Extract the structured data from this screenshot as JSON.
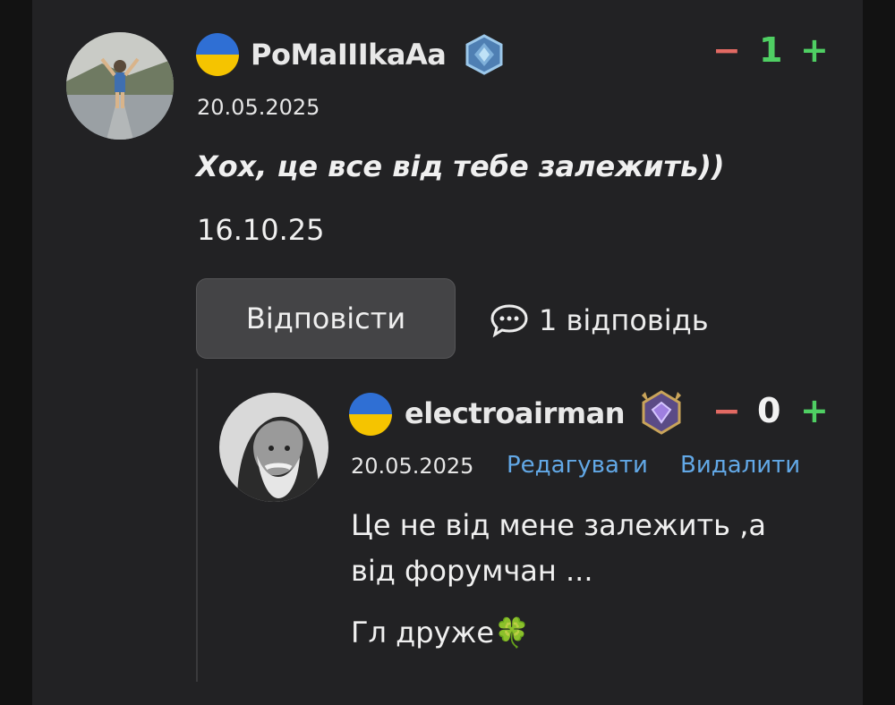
{
  "comment": {
    "username": "PoMaIIIkaAa",
    "date": "20.05.2025",
    "text_italic": "Хох, це все від тебе залежить))",
    "text_line": "16.10.25",
    "votes": {
      "minus": "−",
      "count": "1",
      "plus": "+"
    },
    "reply_button_label": "Відповісти",
    "replies_label": "1 відповідь"
  },
  "reply": {
    "username": "electroairman",
    "date": "20.05.2025",
    "edit_label": "Редагувати",
    "delete_label": "Видалити",
    "votes": {
      "minus": "−",
      "count": "0",
      "plus": "+"
    },
    "text_line1": "Це не від мене залежить ,а",
    "text_line2": "від форумчан ...",
    "text_line3": "Гл друже🍀"
  },
  "colors": {
    "background": "#222224",
    "vote_minus": "#e26a63",
    "vote_plus": "#4fcf63",
    "link": "#62a8e6",
    "flag_blue": "#2f6fd4",
    "flag_yellow": "#f5c400"
  },
  "icons": {
    "comment_badge": "hexagon-badge-icon",
    "reply_badge": "crown-gem-badge-icon",
    "replies": "speech-bubble-icon"
  }
}
